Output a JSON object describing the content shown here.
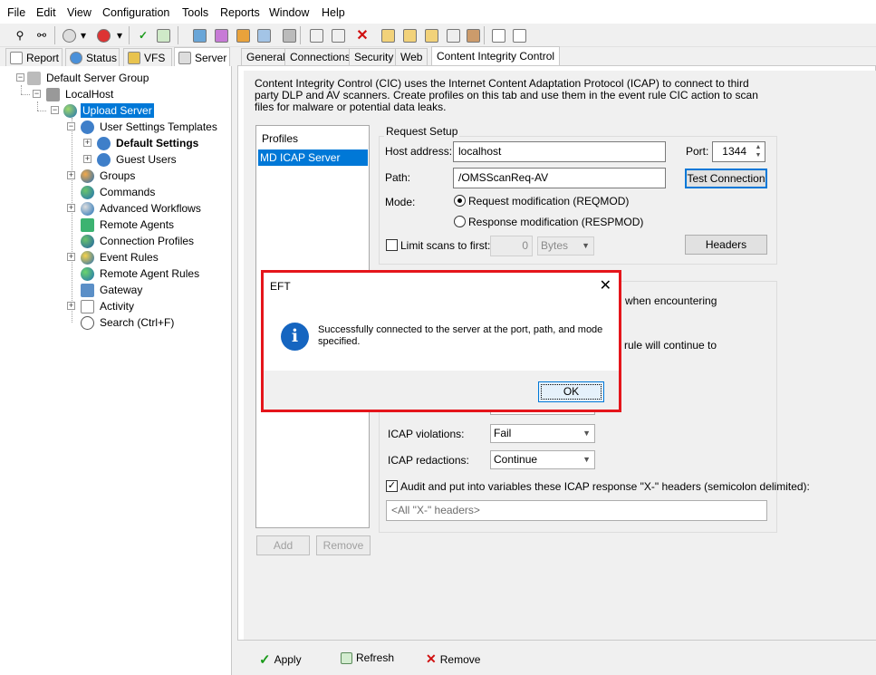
{
  "menu": [
    "File",
    "Edit",
    "View",
    "Configuration",
    "Tools",
    "Reports",
    "Window",
    "Help"
  ],
  "left_tabs": [
    "Report",
    "Status",
    "VFS",
    "Server"
  ],
  "tree": {
    "root": "Default Server Group",
    "host": "LocalHost",
    "site": "Upload Server",
    "ust": "User Settings Templates",
    "default_settings": "Default Settings",
    "guest_users": "Guest Users",
    "groups": "Groups",
    "commands": "Commands",
    "advanced_workflows": "Advanced Workflows",
    "remote_agents": "Remote Agents",
    "connection_profiles": "Connection Profiles",
    "event_rules": "Event Rules",
    "remote_agent_rules": "Remote Agent Rules",
    "gateway": "Gateway",
    "activity": "Activity",
    "search": "Search (Ctrl+F)"
  },
  "right_tabs": [
    "General",
    "Connections",
    "Security",
    "Web",
    "Content Integrity Control"
  ],
  "description": "Content Integrity Control (CIC) uses the Internet Content Adaptation Protocol (ICAP) to connect to third party DLP and AV scanners. Create profiles on this tab and use them in the event rule CIC action to scan files for malware or potential data leaks.",
  "profiles": {
    "header": "Profiles",
    "items": [
      "MD ICAP Server"
    ],
    "add": "Add",
    "remove": "Remove"
  },
  "request_setup": {
    "group_label": "Request Setup",
    "host_label": "Host address:",
    "host_value": "localhost",
    "port_label": "Port:",
    "port_value": "1344",
    "path_label": "Path:",
    "path_value": "/OMSScanReq-AV",
    "test_connection": "Test Connection",
    "mode_label": "Mode:",
    "mode_reqmod": "Request modification (REQMOD)",
    "mode_respmod": "Response modification (RESPMOD)",
    "limit_label": "Limit scans to first:",
    "limit_value": "0",
    "limit_unit": "Bytes",
    "headers": "Headers"
  },
  "partial": {
    "encountering": "when encountering",
    "continue_to": "e rule will continue to"
  },
  "icap": {
    "violations_label": "ICAP violations:",
    "violations_value": "Fail",
    "redactions_label": "ICAP redactions:",
    "redactions_value": "Continue",
    "audit_label": "Audit and put into variables these ICAP response \"X-\" headers (semicolon delimited):",
    "audit_value": "<All \"X-\" headers>"
  },
  "bottom": {
    "apply": "Apply",
    "refresh": "Refresh",
    "remove": "Remove"
  },
  "dialog": {
    "title": "EFT",
    "message": "Successfully connected to the server at the port, path, and mode specified.",
    "ok": "OK"
  },
  "colors": {
    "selection": "#0078d7",
    "dialog_highlight": "#e5151b",
    "info_icon": "#1565c0"
  }
}
